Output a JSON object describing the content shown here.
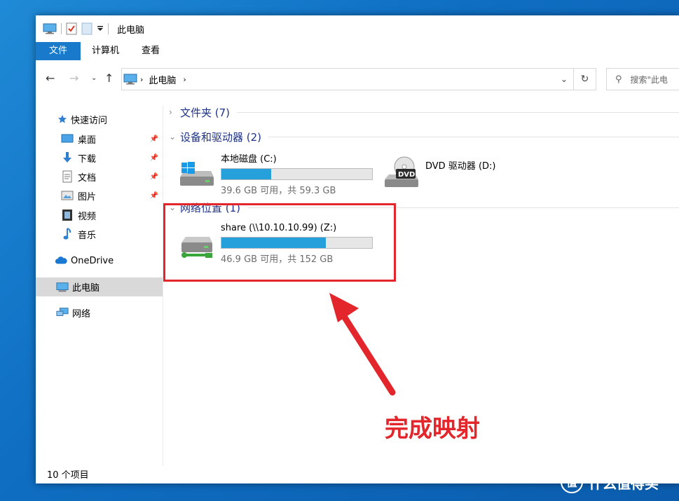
{
  "window": {
    "title": "此电脑"
  },
  "ribbon": {
    "tabs": [
      "文件",
      "计算机",
      "查看"
    ]
  },
  "address": {
    "path": [
      "此电脑"
    ],
    "search_placeholder": "搜索\"此电"
  },
  "nav": {
    "quick_access": "快速访问",
    "pinned": [
      "桌面",
      "下载",
      "文档",
      "图片"
    ],
    "others": [
      "视频",
      "音乐"
    ],
    "onedrive": "OneDrive",
    "this_pc": "此电脑",
    "network": "网络"
  },
  "groups": {
    "folders": "文件夹 (7)",
    "devices": "设备和驱动器 (2)",
    "network_locations": "网络位置 (1)"
  },
  "drives": [
    {
      "name": "本地磁盘 (C:)",
      "size": "39.6 GB 可用，共 59.3 GB",
      "used_fraction": 0.332
    },
    {
      "name": "DVD 驱动器 (D:)",
      "label": "DVD"
    },
    {
      "name": "share (\\\\10.10.10.99) (Z:)",
      "size": "46.9 GB 可用，共 152 GB",
      "used_fraction": 0.691
    }
  ],
  "status": {
    "items": "10 个项目"
  },
  "annotation": {
    "text": "完成映射"
  },
  "watermark": {
    "text": "什么值得买",
    "logo_char": "值"
  },
  "colors": {
    "accent": "#1979ca",
    "bar": "#26a0da",
    "annotation": "#e3262b",
    "group_title": "#1e3287"
  }
}
